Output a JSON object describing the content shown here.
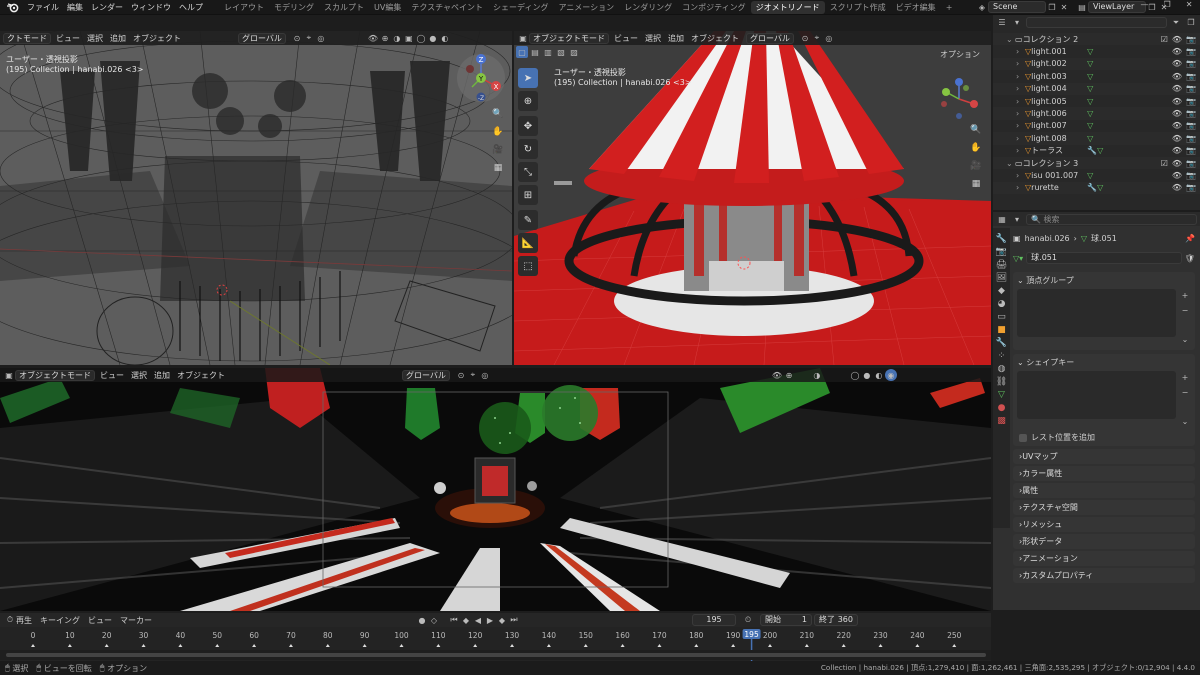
{
  "menu": [
    "ファイル",
    "編集",
    "レンダー",
    "ウィンドウ",
    "ヘルプ"
  ],
  "workspace_tabs": [
    "レイアウト",
    "モデリング",
    "スカルプト",
    "UV編集",
    "テクスチャペイント",
    "シェーディング",
    "アニメーション",
    "レンダリング",
    "コンポジティング",
    "ジオメトリノード",
    "スクリプト作成",
    "ビデオ編集"
  ],
  "active_workspace": "ジオメトリノード",
  "add_tab": "+",
  "scene_name": "Scene",
  "view_layer": "ViewLayer",
  "viewport_left": {
    "mode": "クトモード",
    "menus": [
      "ビュー",
      "選択",
      "追加",
      "オブジェクト"
    ],
    "orientation": "グローバル",
    "view_label": "ユーザー・透視投影",
    "info": "(195) Collection | hanabi.026 <3>"
  },
  "viewport_right": {
    "mode": "オブジェクトモード",
    "menus": [
      "ビュー",
      "選択",
      "追加",
      "オブジェクト"
    ],
    "orientation": "グローバル",
    "options": "オプション",
    "view_label": "ユーザー・透視投影",
    "info": "(195) Collection | hanabi.026 <3>"
  },
  "viewport_bottom": {
    "mode": "オブジェクトモード",
    "menus": [
      "ビュー",
      "選択",
      "追加",
      "オブジェクト"
    ],
    "orientation": "グローバル"
  },
  "gizmo": {
    "z_top": "Z",
    "y": "Y",
    "x": "X",
    "neg_z": "-Z"
  },
  "outliner": {
    "search_placeholder": "",
    "rows": [
      {
        "indent": 1,
        "name": "コレクション 2",
        "type": "collection"
      },
      {
        "indent": 2,
        "name": "light.001",
        "type": "object"
      },
      {
        "indent": 2,
        "name": "light.002",
        "type": "object"
      },
      {
        "indent": 2,
        "name": "light.003",
        "type": "object"
      },
      {
        "indent": 2,
        "name": "light.004",
        "type": "object"
      },
      {
        "indent": 2,
        "name": "light.005",
        "type": "object"
      },
      {
        "indent": 2,
        "name": "light.006",
        "type": "object"
      },
      {
        "indent": 2,
        "name": "light.007",
        "type": "object"
      },
      {
        "indent": 2,
        "name": "light.008",
        "type": "object"
      },
      {
        "indent": 2,
        "name": "トーラス",
        "type": "object"
      },
      {
        "indent": 1,
        "name": "コレクション 3",
        "type": "collection"
      },
      {
        "indent": 2,
        "name": "isu 001.007",
        "type": "object"
      },
      {
        "indent": 2,
        "name": "rurette",
        "type": "object"
      }
    ]
  },
  "properties": {
    "search_placeholder": "検索",
    "breadcrumb_object": "hanabi.026",
    "breadcrumb_data": "球.051",
    "data_name": "球.051",
    "panels_top": [
      "頂点グループ",
      "シェイプキー"
    ],
    "rest_position": "レスト位置を追加",
    "panels": [
      "UVマップ",
      "カラー属性",
      "属性",
      "テクスチャ空間",
      "リメッシュ",
      "形状データ",
      "アニメーション",
      "カスタムプロパティ"
    ]
  },
  "timeline": {
    "menus": [
      "再生",
      "キーイング",
      "ビュー",
      "マーカー"
    ],
    "current_frame": "195",
    "start_label": "開始",
    "start": "1",
    "end_label": "終了",
    "end": "360",
    "ticks": [
      "0",
      "10",
      "20",
      "30",
      "40",
      "50",
      "60",
      "70",
      "80",
      "90",
      "100",
      "110",
      "120",
      "130",
      "140",
      "150",
      "160",
      "170",
      "180",
      "190",
      "200",
      "210",
      "220",
      "230",
      "240",
      "250"
    ]
  },
  "status": {
    "left": [
      "選択",
      "ビューを回転",
      "オプション"
    ],
    "right": "Collection | hanabi.026 | 頂点:1,279,410 | 面:1,262,461 | 三角面:2,535,295 | オブジェクト:0/12,904 | 4.4.0"
  },
  "colors": {
    "accent": "#4772b3",
    "frame": "#4772b3",
    "tent_red": "#d21f1f",
    "floor_red": "#c61b1b"
  }
}
